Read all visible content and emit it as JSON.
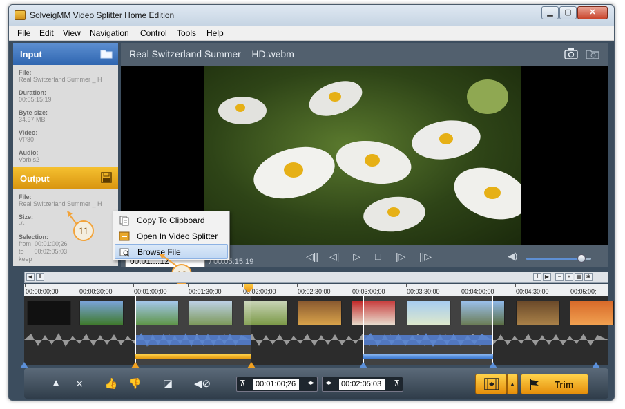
{
  "window": {
    "title": "SolveigMM Video Splitter Home Edition"
  },
  "window_buttons": {
    "minimize": "▁",
    "maximize": "▢",
    "close": "✕"
  },
  "menu": [
    "File",
    "Edit",
    "View",
    "Navigation",
    "Control",
    "Tools",
    "Help"
  ],
  "input_panel": {
    "header": "Input",
    "fields": [
      {
        "label": "File:",
        "value": "Real Switzerland Summer _ H"
      },
      {
        "label": "Duration:",
        "value": "00:05;15;19"
      },
      {
        "label": "Byte size:",
        "value": "34.97 MB"
      },
      {
        "label": "Video:",
        "value": "VP80"
      },
      {
        "label": "Audio:",
        "value": "Vorbis2"
      }
    ]
  },
  "output_panel": {
    "header": "Output",
    "file_label": "File:",
    "file_value": "Real Switzerland Summer _ H",
    "size_label": "Size:",
    "size_value": "-/-",
    "selection_label": "Selection:",
    "from_label": "from",
    "from_value": "00:01:00;26",
    "to_label": "to",
    "to_value": "00:02:05;03",
    "mode": "keep"
  },
  "video": {
    "title": "Real Switzerland Summer _ HD.webm",
    "current_time": "00:01:...12",
    "duration": "/ 00:05:15;19",
    "volume": 0.85
  },
  "context_menu": {
    "items": [
      "Copy To Clipboard",
      "Open In Video Splitter",
      "Browse File"
    ],
    "highlighted_index": 2
  },
  "callouts": [
    "11",
    "12"
  ],
  "timeline": {
    "ticks": [
      "00:00:00;00",
      "00:00:30;00",
      "00:01:00;00",
      "00:01:30;00",
      "00:02:00;00",
      "00:02:30;00",
      "00:03:00;00",
      "00:03:30;00",
      "00:04:00;00",
      "00:04:30;00",
      "00:05:00;"
    ]
  },
  "bottom_bar": {
    "start_time": "00:01:00;26",
    "end_time": "00:02:05;03",
    "trim_label": "Trim"
  },
  "colors": {
    "accent_blue": "#3a78d3",
    "accent_orange": "#e59a10",
    "frame": "#3c4d5e"
  }
}
